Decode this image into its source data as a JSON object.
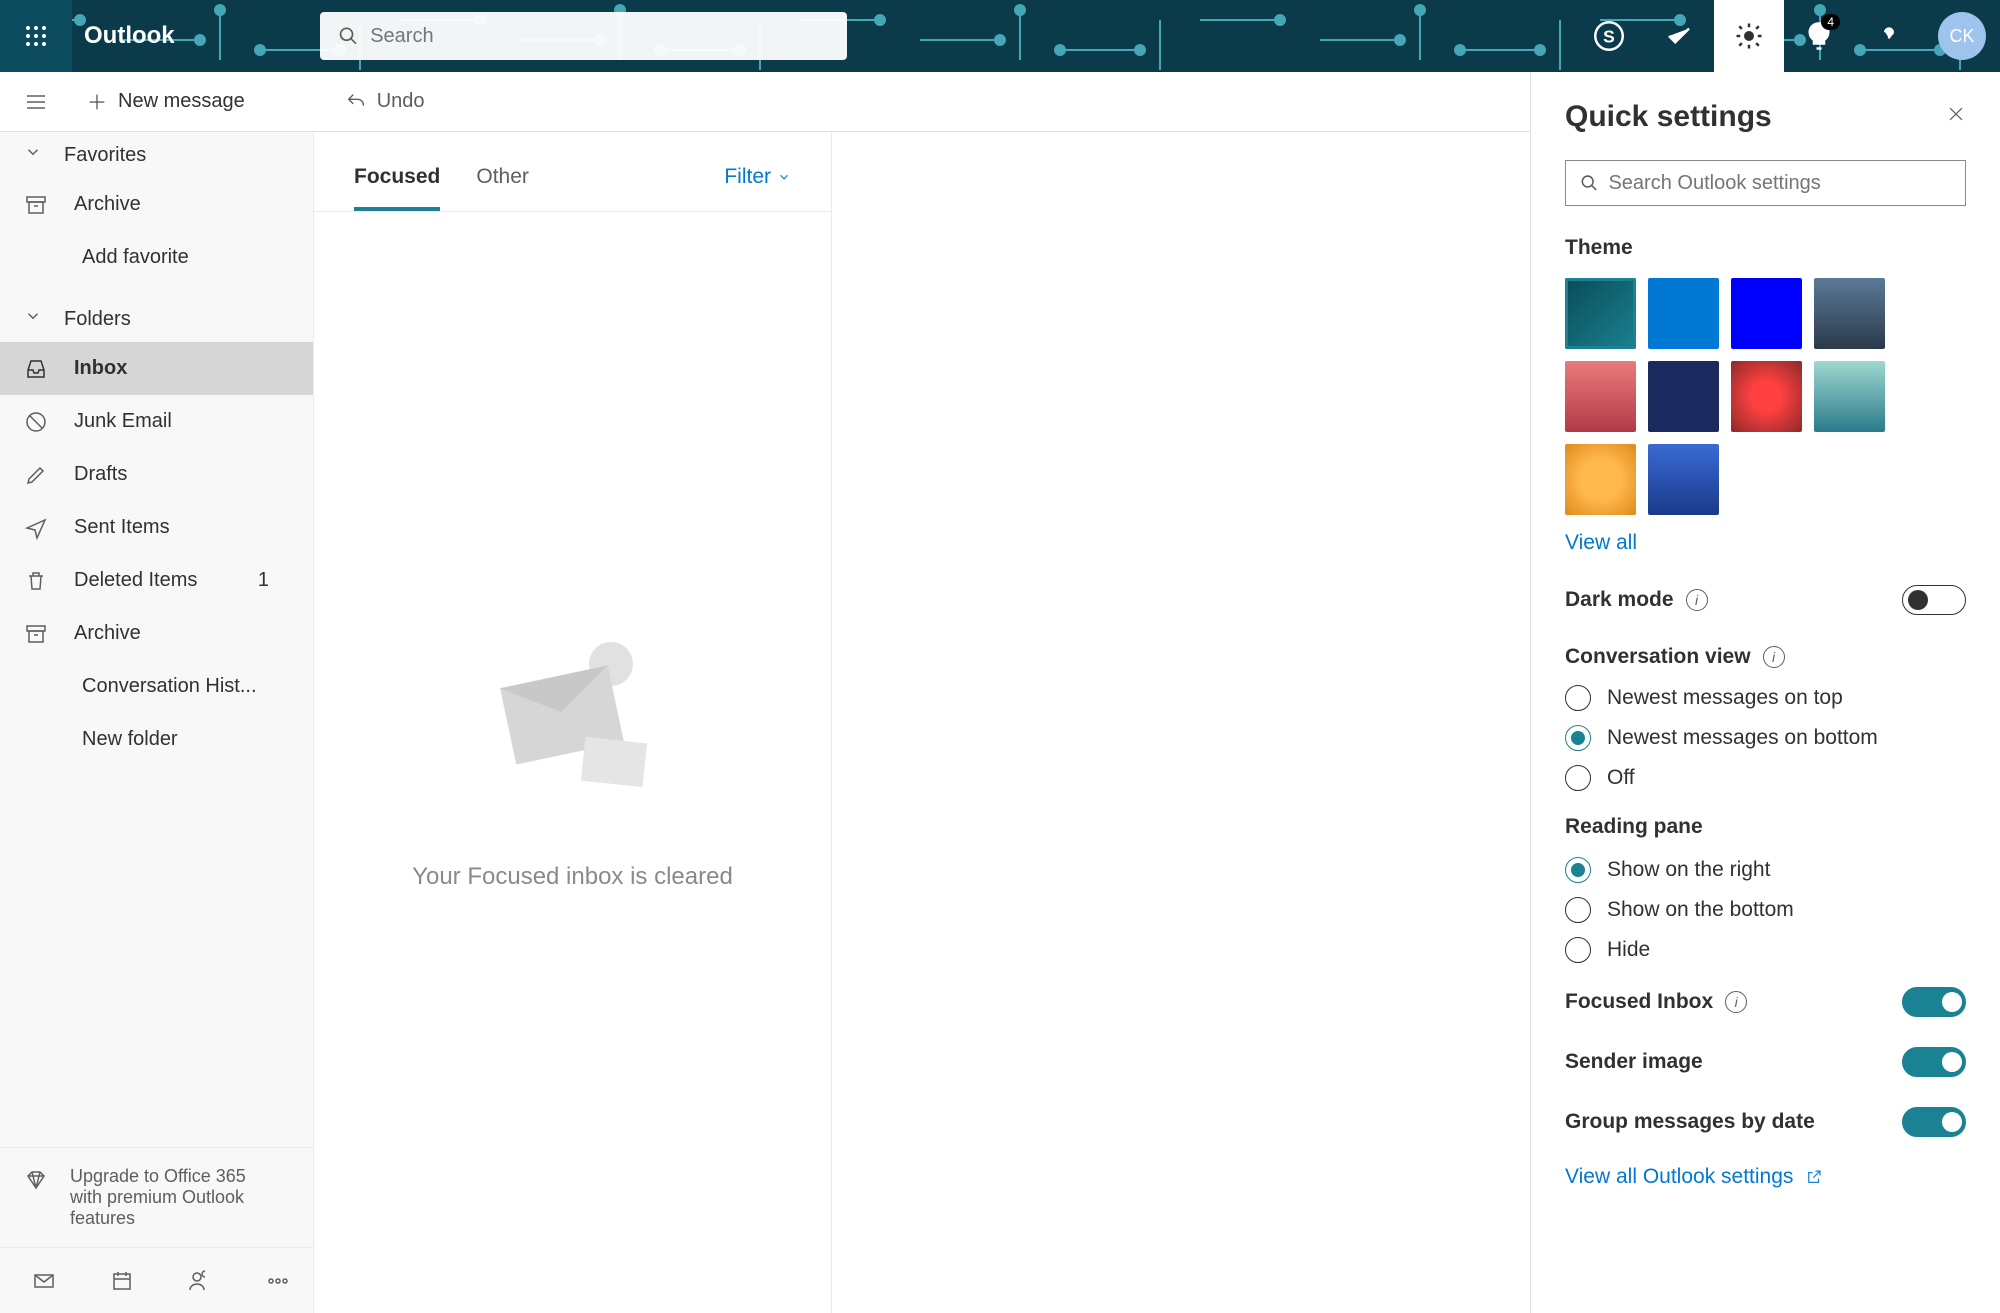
{
  "header": {
    "brand": "Outlook",
    "search_placeholder": "Search",
    "notification_count": "4",
    "avatar_initials": "CK"
  },
  "toolbar": {
    "new_message": "New message",
    "undo": "Undo"
  },
  "sidebar": {
    "favorites_label": "Favorites",
    "favorites": [
      {
        "label": "Archive"
      },
      {
        "label": "Add favorite"
      }
    ],
    "folders_label": "Folders",
    "folders": [
      {
        "label": "Inbox"
      },
      {
        "label": "Junk Email"
      },
      {
        "label": "Drafts"
      },
      {
        "label": "Sent Items"
      },
      {
        "label": "Deleted Items",
        "count": "1"
      },
      {
        "label": "Archive"
      },
      {
        "label": "Conversation Hist..."
      },
      {
        "label": "New folder"
      }
    ],
    "upgrade_text": "Upgrade to Office 365 with premium Outlook features"
  },
  "message_list": {
    "tab_focused": "Focused",
    "tab_other": "Other",
    "filter": "Filter",
    "empty_text": "Your Focused inbox is cleared"
  },
  "settings": {
    "title": "Quick settings",
    "search_placeholder": "Search Outlook settings",
    "theme_label": "Theme",
    "view_all": "View all",
    "dark_mode": "Dark mode",
    "conversation_view": "Conversation view",
    "conv_opts": [
      "Newest messages on top",
      "Newest messages on bottom",
      "Off"
    ],
    "reading_pane": "Reading pane",
    "reading_opts": [
      "Show on the right",
      "Show on the bottom",
      "Hide"
    ],
    "focused_inbox": "Focused Inbox",
    "sender_image": "Sender image",
    "group_by_date": "Group messages by date",
    "view_all_settings": "View all Outlook settings"
  },
  "theme_colors": [
    "linear-gradient(135deg,#0b4a57,#1a8292)",
    "#0078d4",
    "#0000ff",
    "linear-gradient(#5b7a99,#2b3a4a)",
    "linear-gradient(#e97b7b,#b23a48)",
    "#1a2a5e",
    "radial-gradient(circle,#ff4040 30%,#8a2a2a)",
    "linear-gradient(#9fd8d0,#2a7a8a)",
    "radial-gradient(circle,#ffb84d 40%,#e08a1a)",
    "linear-gradient(#3a6ad4,#1a3a8a)"
  ]
}
